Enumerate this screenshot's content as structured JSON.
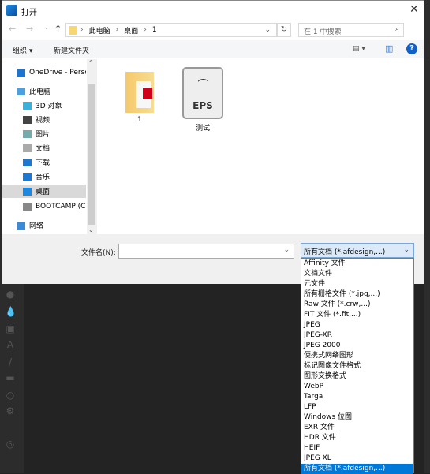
{
  "dialog": {
    "title": "打开",
    "close": "✕"
  },
  "nav": {
    "back": "←",
    "forward": "→",
    "recent": "⌄",
    "up": "↑",
    "breadcrumb": [
      "此电脑",
      "桌面",
      "1"
    ],
    "separator": "›",
    "dropdown": "⌄",
    "refresh": "↻",
    "search_placeholder": "在 1 中搜索",
    "search_icon": "⌕"
  },
  "toolbar": {
    "organize": "组织 ▾",
    "new_folder": "新建文件夹",
    "view": "▤ ▾",
    "pane": "▥",
    "help": "?"
  },
  "sidebar": {
    "items": [
      {
        "label": "OneDrive - Personal",
        "icon": "cloud-icon",
        "color": "#1b75d0"
      },
      {
        "label": "此电脑",
        "icon": "computer-icon",
        "color": "#4aa0e0"
      },
      {
        "label": "3D 对象",
        "icon": "cube-icon",
        "color": "#3cb0d8"
      },
      {
        "label": "视频",
        "icon": "video-icon",
        "color": "#444"
      },
      {
        "label": "图片",
        "icon": "pictures-icon",
        "color": "#7aa"
      },
      {
        "label": "文档",
        "icon": "document-icon",
        "color": "#aaa"
      },
      {
        "label": "下载",
        "icon": "download-icon",
        "color": "#1e78d0"
      },
      {
        "label": "音乐",
        "icon": "music-icon",
        "color": "#1e78d0"
      },
      {
        "label": "桌面",
        "icon": "desktop-icon",
        "color": "#1e88e0",
        "selected": true
      },
      {
        "label": "BOOTCAMP (C:)",
        "icon": "drive-icon",
        "color": "#888"
      },
      {
        "label": "网络",
        "icon": "network-icon",
        "color": "#3a8ad8"
      }
    ]
  },
  "files": [
    {
      "name": "1",
      "icon": "folder-icon"
    },
    {
      "name": "测试",
      "icon": "eps-file-icon",
      "badge": "EPS"
    }
  ],
  "bottom": {
    "filename_label": "文件名(N):",
    "filename_value": "",
    "filetype_selected": "所有文档 (*.afdesign,...)",
    "chev": "⌄"
  },
  "filetype_options": [
    "Affinity 文件",
    "文档文件",
    "元文件",
    "所有栅格文件 (*.jpg,...)",
    "Raw 文件 (*.crw,...)",
    "FIT 文件 (*.fit,...)",
    "JPEG",
    "JPEG-XR",
    "JPEG 2000",
    "便携式网络图形",
    "标记图像文件格式",
    "图形交换格式",
    "WebP",
    "Targa",
    "LFP",
    "Windows 位图",
    "EXR 文件",
    "HDR 文件",
    "HEIF",
    "JPEG XL",
    "所有文档 (*.afdesign,...)"
  ],
  "colors": {
    "accent": "#0078d7",
    "app_bg": "#232323"
  }
}
